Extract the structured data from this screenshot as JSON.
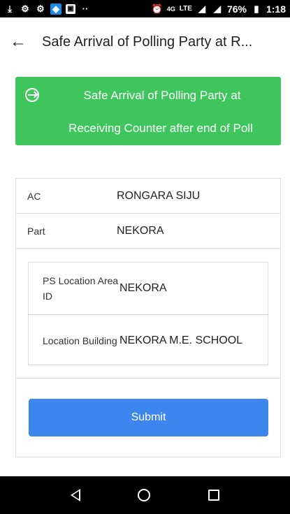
{
  "status_bar": {
    "left_icons": [
      "download-icon",
      "app-icon",
      "app-icon",
      "app-icon",
      "image-icon",
      "more-icon"
    ],
    "network": "4G",
    "lte": "LTE",
    "battery": "76%",
    "time": "1:18"
  },
  "app_bar": {
    "title": "Safe Arrival of Polling Party at R..."
  },
  "banner": {
    "line1": "Safe Arrival of Polling Party at",
    "line2": "Receiving Counter after end of Poll",
    "color": "#3ec65c"
  },
  "details": {
    "ac": {
      "label": "AC",
      "value": "RONGARA SIJU"
    },
    "part": {
      "label": "Part",
      "value": "NEKORA"
    },
    "ps_location": {
      "label": "PS Location Area ID",
      "value": "NEKORA"
    },
    "location_building": {
      "label": "Location Building",
      "value": "NEKORA M.E. SCHOOL"
    }
  },
  "submit": {
    "label": "Submit",
    "color": "#3d86ee"
  }
}
